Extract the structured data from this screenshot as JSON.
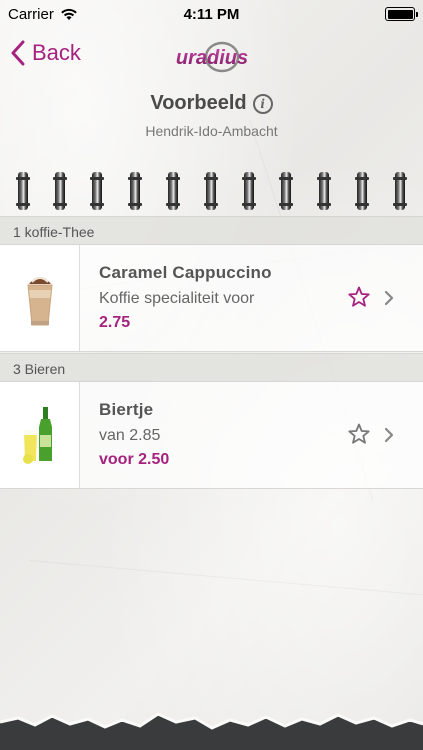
{
  "status_bar": {
    "carrier": "Carrier",
    "time": "4:11 PM",
    "battery_level": 1.0
  },
  "nav": {
    "back_label": "Back",
    "logo_text": "uradius"
  },
  "header": {
    "title": "Voorbeeld",
    "location": "Hendrik-Ido-Ambacht"
  },
  "sections": [
    {
      "header": "1 koffie-Thee",
      "items": [
        {
          "name": "Caramel Cappuccino",
          "description": "Koffie specialiteit voor",
          "price": "2.75",
          "favorite": true
        }
      ]
    },
    {
      "header": "3 Bieren",
      "items": [
        {
          "name": "Biertje",
          "description": "van 2.85",
          "price": "voor 2.50",
          "favorite": false
        }
      ]
    }
  ],
  "colors": {
    "accent": "#a5227f",
    "star_inactive": "#777777"
  }
}
